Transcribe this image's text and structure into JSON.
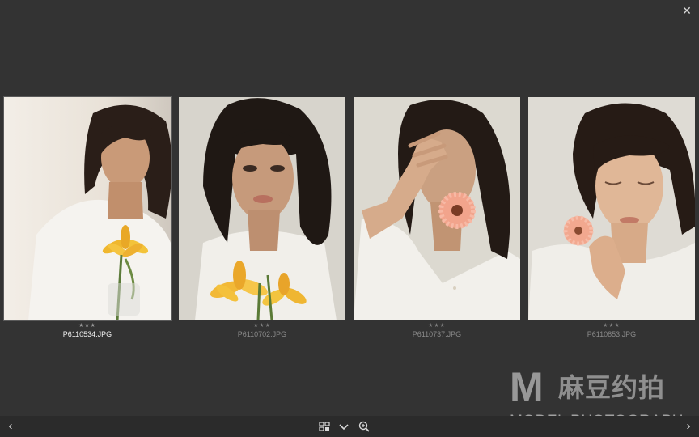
{
  "window": {
    "close_icon": "close-icon"
  },
  "filmstrip": [
    {
      "filename": "P6110534.JPG",
      "rating": "★★★",
      "selected": true
    },
    {
      "filename": "P6110702.JPG",
      "rating": "★★★",
      "selected": false
    },
    {
      "filename": "P6110737.JPG",
      "rating": "★★★",
      "selected": false
    },
    {
      "filename": "P6110853.JPG",
      "rating": "★★★",
      "selected": false
    }
  ],
  "toolbar": {
    "prev_icon": "chevron-left-icon",
    "next_icon": "chevron-right-icon",
    "view_icon": "grid-view-icon",
    "dropdown_icon": "chevron-down-icon",
    "zoom_icon": "zoom-in-icon"
  },
  "watermark": {
    "letter": "M",
    "chinese": "麻豆约拍",
    "english": "MODEL PHOTOGRAPH"
  },
  "colors": {
    "background": "#333333",
    "bar": "#2b2b2b",
    "selected_text": "#f2f2f2",
    "muted_text": "#8a8a8a"
  }
}
